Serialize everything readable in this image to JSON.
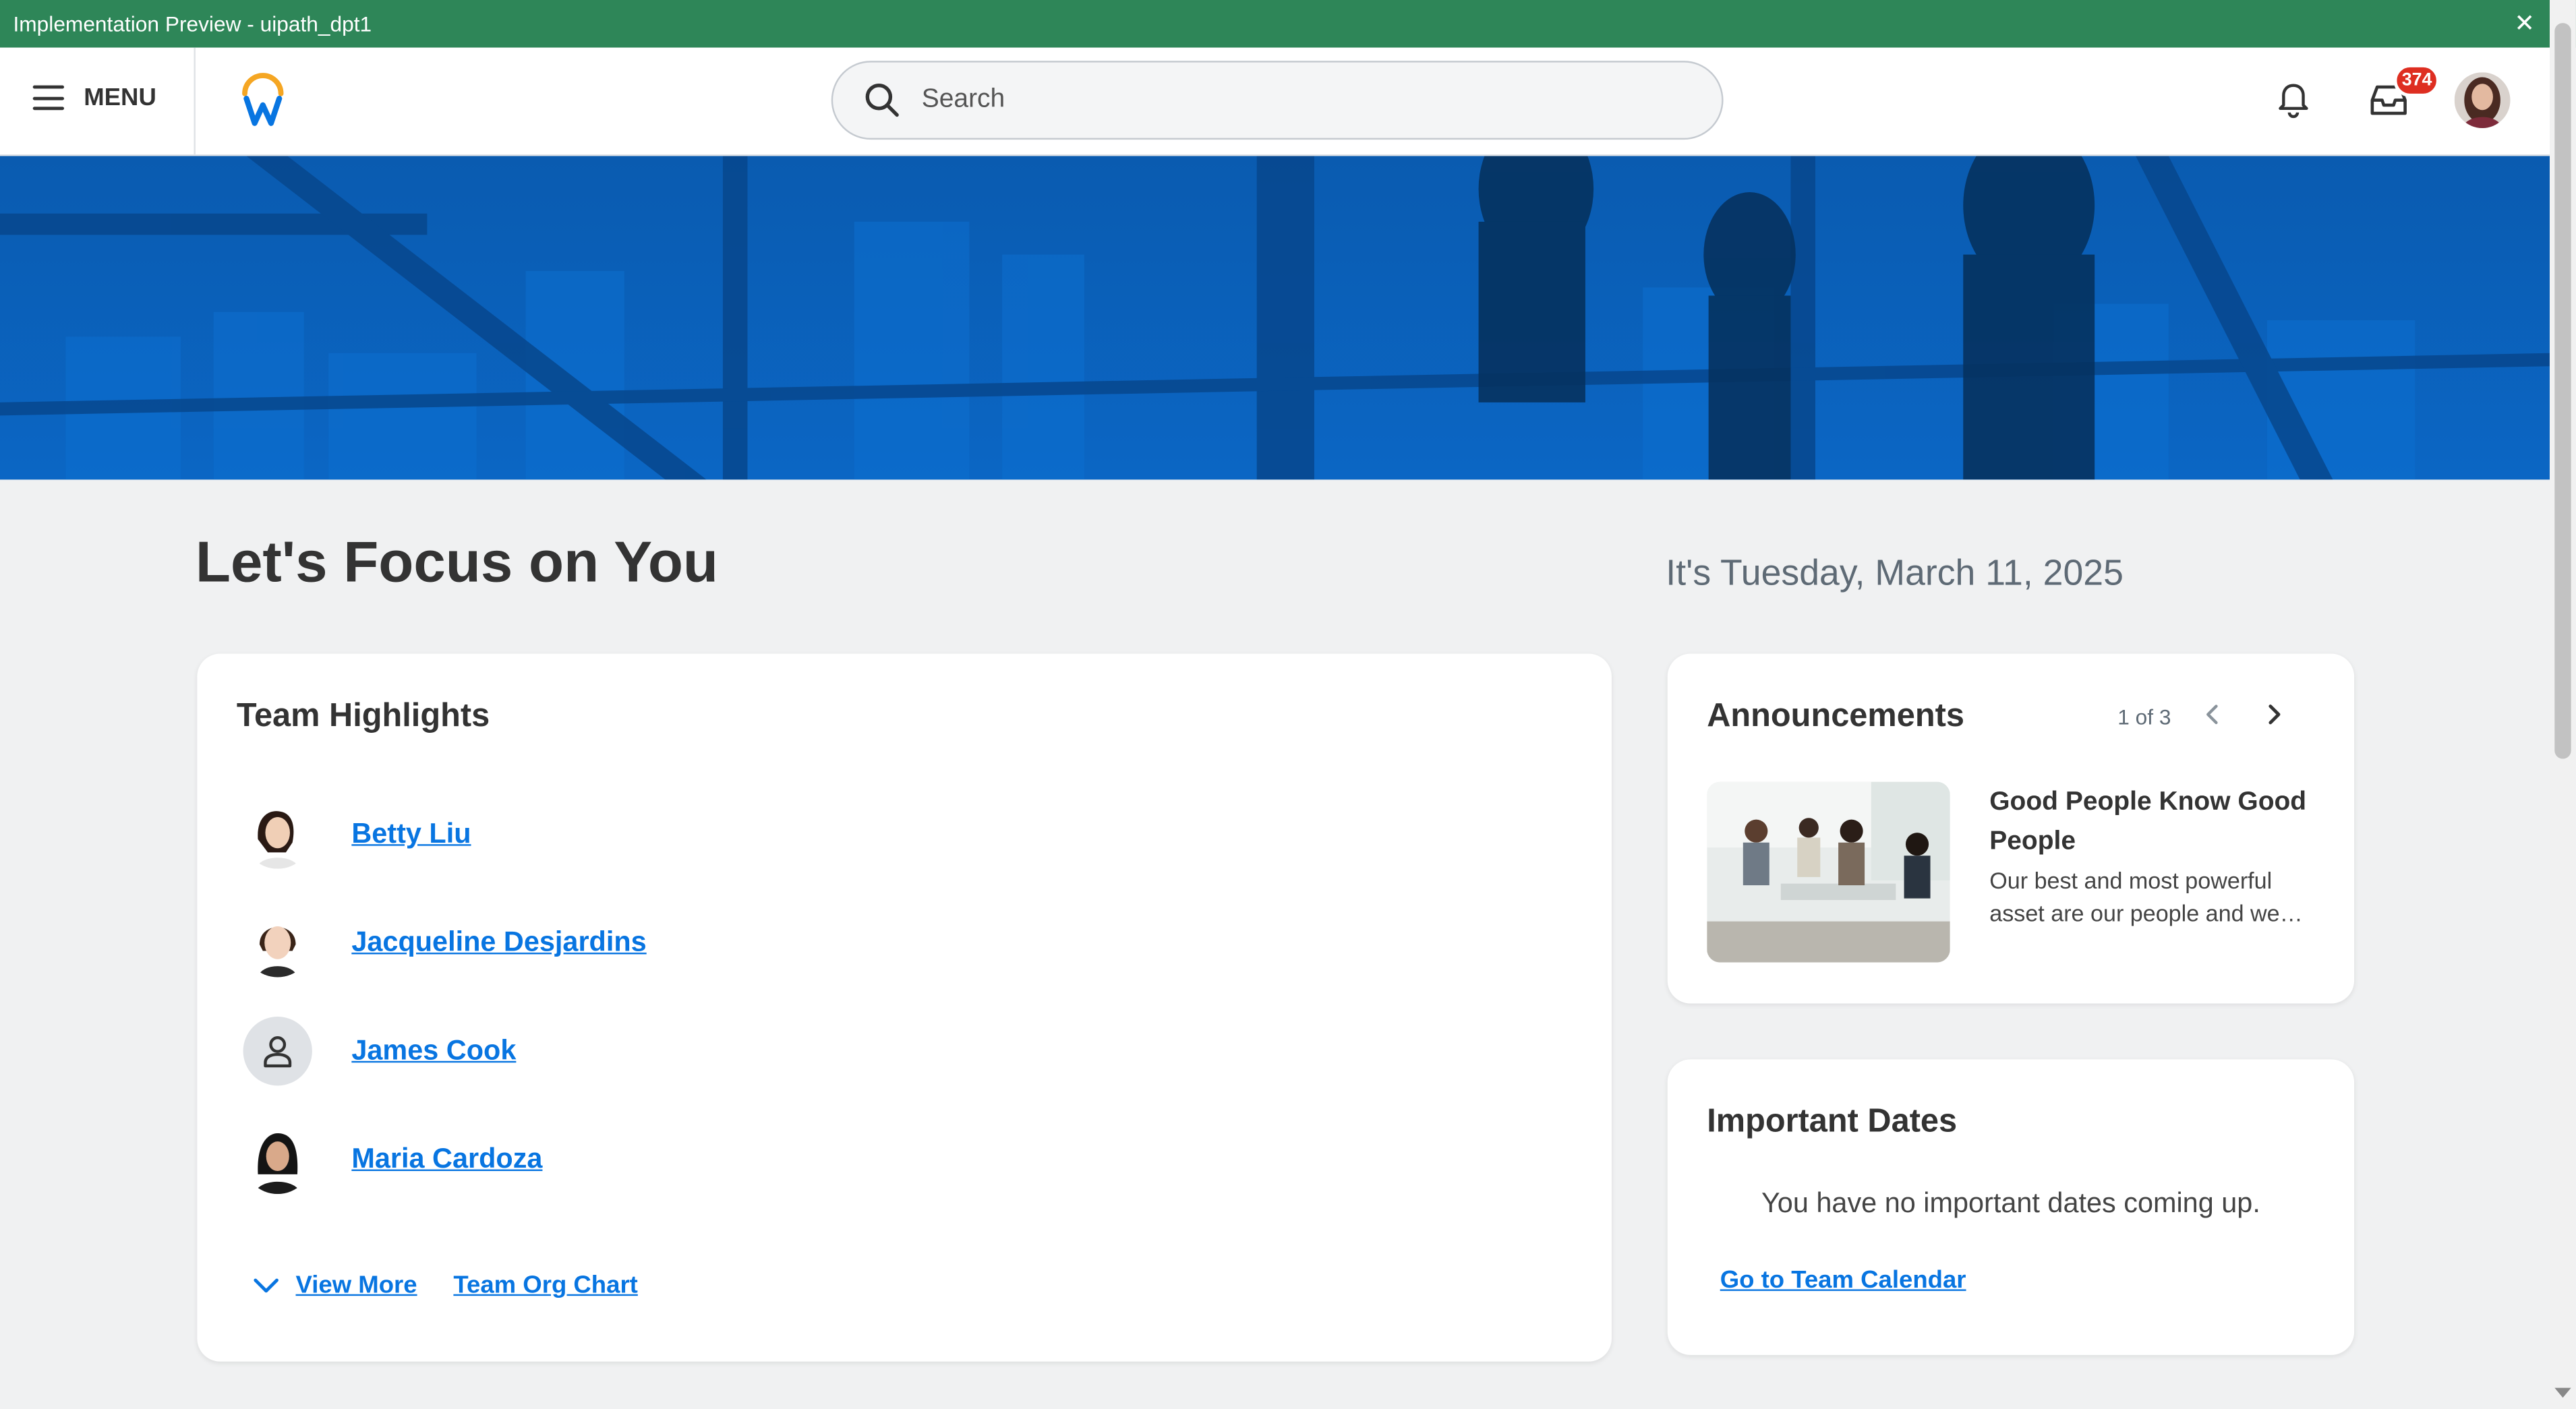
{
  "preview_bar": {
    "title": "Implementation Preview - uipath_dpt1",
    "close_icon": "close-icon"
  },
  "header": {
    "menu_label": "MENU",
    "search_placeholder": "Search",
    "inbox_count": "374",
    "icons": [
      "menu-icon",
      "workday-logo",
      "search-icon",
      "bell-icon",
      "inbox-icon",
      "avatar"
    ]
  },
  "page": {
    "title": "Let's Focus on You",
    "date": "It's Tuesday, March 11, 2025"
  },
  "team_highlights": {
    "title": "Team Highlights",
    "members": [
      {
        "name": "Betty Liu"
      },
      {
        "name": "Jacqueline Desjardins"
      },
      {
        "name": "James Cook"
      },
      {
        "name": "Maria Cardoza"
      }
    ],
    "view_more_label": "View More",
    "org_chart_label": "Team Org Chart"
  },
  "announcements": {
    "title": "Announcements",
    "pager": "1 of 3",
    "headline": "Good People Know Good People",
    "body": "Our best and most powerful asset are our people and we want to hear about great talent you know."
  },
  "important_dates": {
    "title": "Important Dates",
    "empty_message": "You have no important dates coming up.",
    "calendar_link": "Go to Team Calendar"
  },
  "colors": {
    "preview_bar": "#2e8658",
    "link": "#0875e1",
    "hero": "#0b5fb8",
    "badge": "#de2e21",
    "background": "#f0f1f2"
  }
}
